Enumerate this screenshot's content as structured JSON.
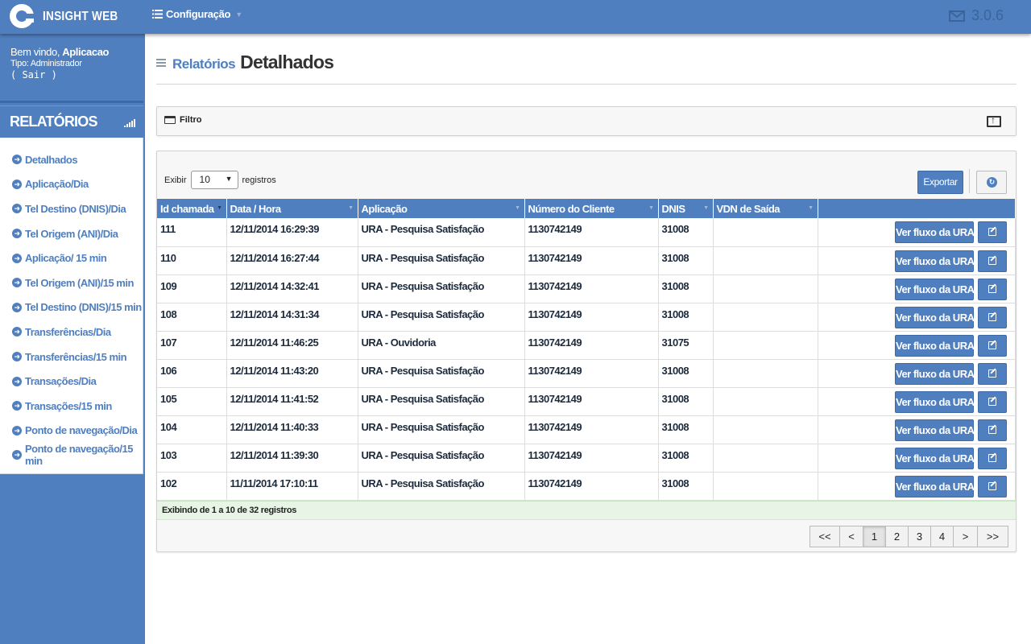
{
  "app": {
    "brand": "INSIGHT WEB",
    "menu_config": "Configuração",
    "version": "3.0.6",
    "accent_color": "#4f7fbf"
  },
  "user": {
    "welcome_prefix": "Bem vindo,",
    "name": "Aplicacao",
    "type": "Tipo: Administrador",
    "logout": "( Sair )"
  },
  "sidebar": {
    "header": "RELATÓRIOS",
    "items": [
      {
        "label": "Detalhados"
      },
      {
        "label": "Aplicação/Dia"
      },
      {
        "label": "Tel Destino (DNIS)/Dia"
      },
      {
        "label": "Tel Origem (ANI)/Dia"
      },
      {
        "label": "Aplicação/ 15 min"
      },
      {
        "label": "Tel Origem (ANI)/15 min"
      },
      {
        "label": "Tel Destino (DNIS)/15 min"
      },
      {
        "label": "Transferências/Dia"
      },
      {
        "label": "Transferências/15 min"
      },
      {
        "label": "Transações/Dia"
      },
      {
        "label": "Transações/15 min"
      },
      {
        "label": "Ponto de navegação/Dia"
      },
      {
        "label": "Ponto de navegação/15 min"
      }
    ]
  },
  "page": {
    "breadcrumb": "Relatórios",
    "title": "Detalhados"
  },
  "filter": {
    "label": "Filtro"
  },
  "table_controls": {
    "show_label": "Exibir",
    "page_size": "10",
    "records_label": "registros",
    "export_label": "Exportar"
  },
  "table": {
    "columns": [
      "Id chamada",
      "Data / Hora",
      "Aplicação",
      "Número do Cliente",
      "DNIS",
      "VDN de Saída",
      ""
    ],
    "action_label": "Ver fluxo da URA",
    "rows": [
      {
        "id": "111",
        "datetime": "12/11/2014 16:29:39",
        "app": "URA - Pesquisa Satisfação",
        "client": "1130742149",
        "dnis": "31008",
        "vdn": ""
      },
      {
        "id": "110",
        "datetime": "12/11/2014 16:27:44",
        "app": "URA - Pesquisa Satisfação",
        "client": "1130742149",
        "dnis": "31008",
        "vdn": ""
      },
      {
        "id": "109",
        "datetime": "12/11/2014 14:32:41",
        "app": "URA - Pesquisa Satisfação",
        "client": "1130742149",
        "dnis": "31008",
        "vdn": ""
      },
      {
        "id": "108",
        "datetime": "12/11/2014 14:31:34",
        "app": "URA - Pesquisa Satisfação",
        "client": "1130742149",
        "dnis": "31008",
        "vdn": ""
      },
      {
        "id": "107",
        "datetime": "12/11/2014 11:46:25",
        "app": "URA - Ouvidoria",
        "client": "1130742149",
        "dnis": "31075",
        "vdn": ""
      },
      {
        "id": "106",
        "datetime": "12/11/2014 11:43:20",
        "app": "URA - Pesquisa Satisfação",
        "client": "1130742149",
        "dnis": "31008",
        "vdn": ""
      },
      {
        "id": "105",
        "datetime": "12/11/2014 11:41:52",
        "app": "URA - Pesquisa Satisfação",
        "client": "1130742149",
        "dnis": "31008",
        "vdn": ""
      },
      {
        "id": "104",
        "datetime": "12/11/2014 11:40:33",
        "app": "URA - Pesquisa Satisfação",
        "client": "1130742149",
        "dnis": "31008",
        "vdn": ""
      },
      {
        "id": "103",
        "datetime": "12/11/2014 11:39:30",
        "app": "URA - Pesquisa Satisfação",
        "client": "1130742149",
        "dnis": "31008",
        "vdn": ""
      },
      {
        "id": "102",
        "datetime": "11/11/2014 17:10:11",
        "app": "URA - Pesquisa Satisfação",
        "client": "1130742149",
        "dnis": "31008",
        "vdn": ""
      }
    ],
    "info": "Exibindo de 1 a 10 de 32 registros"
  },
  "pagination": {
    "first": "<<",
    "prev": "<",
    "pages": [
      "1",
      "2",
      "3",
      "4"
    ],
    "active": "1",
    "next": ">",
    "last": ">>"
  }
}
